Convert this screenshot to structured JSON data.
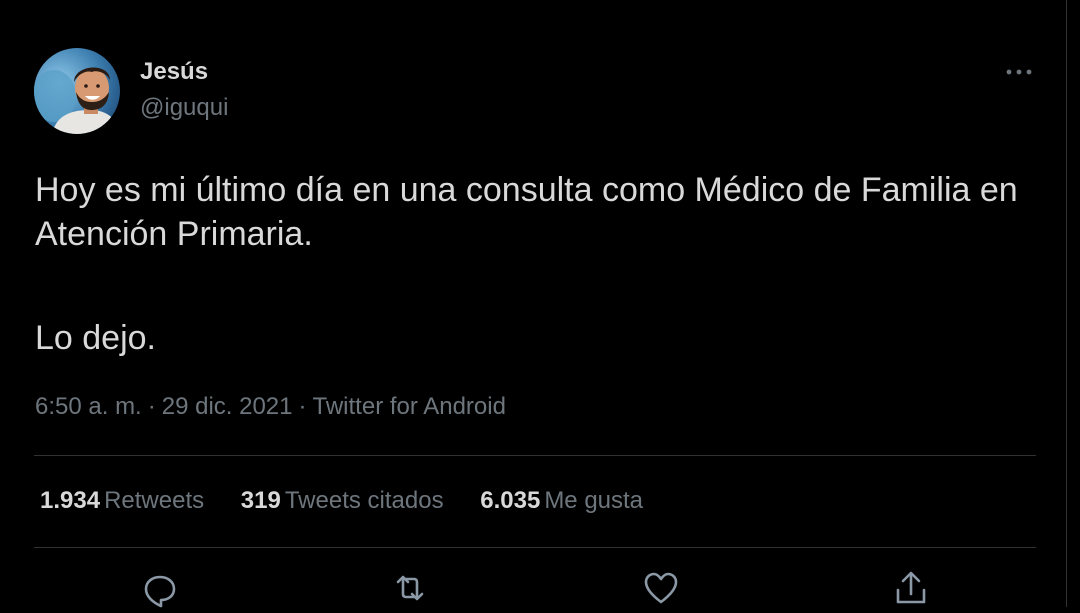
{
  "author": {
    "name": "Jesús",
    "handle": "@iguqui"
  },
  "tweet": {
    "line1": "Hoy es mi último día en una consulta como Médico de Familia en Atención Primaria.",
    "line2": "Lo dejo."
  },
  "meta": {
    "time": "6:50 a. m.",
    "separator": "·",
    "date": "29 dic. 2021",
    "source": "Twitter for Android"
  },
  "stats": {
    "retweets": {
      "count": "1.934",
      "label": "Retweets"
    },
    "quotes": {
      "count": "319",
      "label": "Tweets citados"
    },
    "likes": {
      "count": "6.035",
      "label": "Me gusta"
    }
  },
  "colors": {
    "background": "#000000",
    "text": "#d9d9d9",
    "muted": "#6e767d",
    "divider": "#2f3336"
  },
  "icons": {
    "more": "more-horizontal-icon",
    "reply": "reply-icon",
    "retweet": "retweet-icon",
    "like": "heart-icon",
    "share": "share-icon"
  }
}
